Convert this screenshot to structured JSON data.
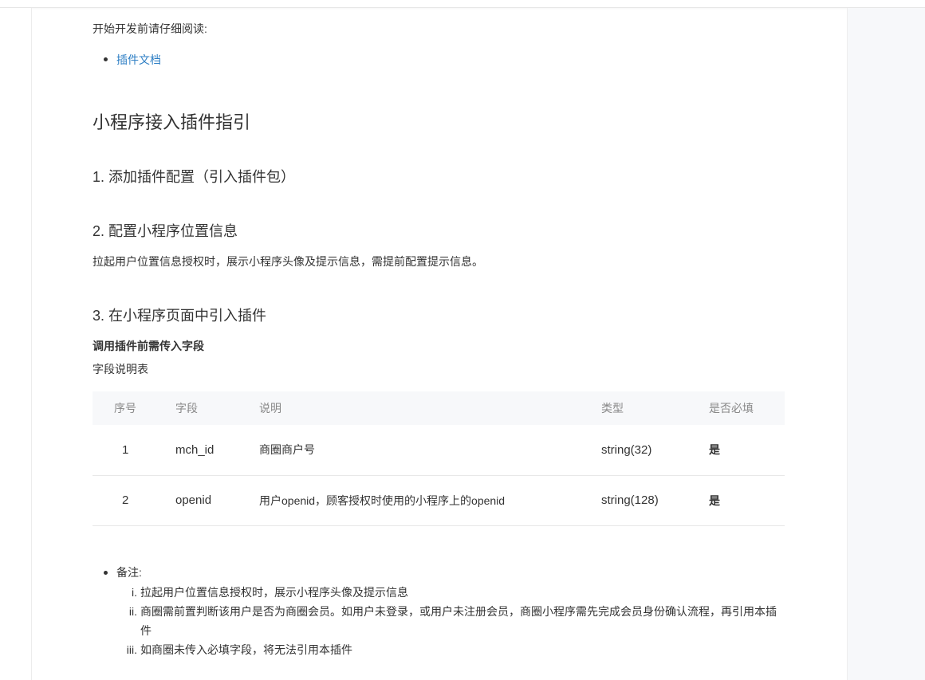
{
  "intro": {
    "text": "开始开发前请仔细阅读:",
    "links": [
      "插件文档"
    ]
  },
  "heading_main": "小程序接入插件指引",
  "sections": [
    {
      "title": "1. 添加插件配置（引入插件包）"
    },
    {
      "title": "2. 配置小程序位置信息",
      "paragraph": "拉起用户位置信息授权时，展示小程序头像及提示信息，需提前配置提示信息。"
    },
    {
      "title": "3. 在小程序页面中引入插件",
      "bold": "调用插件前需传入字段",
      "caption": "字段说明表"
    }
  ],
  "table": {
    "headers": [
      "序号",
      "字段",
      "说明",
      "类型",
      "是否必填"
    ],
    "rows": [
      {
        "idx": "1",
        "field": "mch_id",
        "desc": "商圈商户号",
        "type": "string(32)",
        "required": "是"
      },
      {
        "idx": "2",
        "field": "openid",
        "desc": "用户openid，顾客授权时使用的小程序上的openid",
        "type": "string(128)",
        "required": "是"
      }
    ]
  },
  "notes": {
    "label": "备注:",
    "items": [
      {
        "marker": "i.",
        "text": "拉起用户位置信息授权时，展示小程序头像及提示信息"
      },
      {
        "marker": "ii.",
        "text": "商圈需前置判断该用户是否为商圈会员。如用户未登录，或用户未注册会员，商圈小程序需先完成会员身份确认流程，再引用本插件"
      },
      {
        "marker": "iii.",
        "text": "如商圈未传入必填字段，将无法引用本插件"
      }
    ]
  },
  "colors": {
    "link": "#2d7ec4",
    "text": "#333333",
    "table_header_bg": "#f7f8fa",
    "table_header_text": "#888888",
    "right_panel_bg": "#f7f8fa"
  }
}
